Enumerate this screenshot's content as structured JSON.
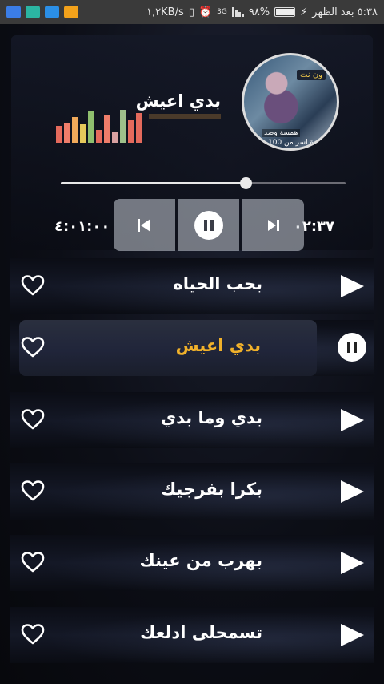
{
  "status_bar": {
    "time": "٥:٣٨ بعد الظهر",
    "battery": "%٩٨",
    "network": "١,٢KB/s"
  },
  "player": {
    "now_playing_title": "بدي اعيش",
    "elapsed": "٠٢:٣٧",
    "duration": "٤:٠١:٠٠",
    "progress": 0.65,
    "album_art_text": [
      "ون نت",
      "همسة وصد",
      "ة اسر من 100"
    ]
  },
  "equalizer_colors": [
    "#e46a5c",
    "#ef7d6a",
    "#f0a95a",
    "#e5c85b",
    "#8fbf6e",
    "#e46a5c",
    "#ef7d6a",
    "#d8a0a0",
    "#9ec08a",
    "#e46a5c",
    "#e46a5c"
  ],
  "equalizer_levels": [
    0.45,
    0.55,
    0.7,
    0.5,
    0.85,
    0.35,
    0.75,
    0.3,
    0.9,
    0.6,
    0.8
  ],
  "songs": [
    {
      "title": "بحب الحياه",
      "active": false
    },
    {
      "title": "بدي اعيش",
      "active": true
    },
    {
      "title": "بدي وما بدي",
      "active": false
    },
    {
      "title": "بكرا بفرجيك",
      "active": false
    },
    {
      "title": "بهرب من عينك",
      "active": false
    },
    {
      "title": "تسمحلى ادلعك",
      "active": false
    }
  ],
  "colors": {
    "active_title": "#f0b12a",
    "status_bar_bg": "#3a3a3a"
  }
}
